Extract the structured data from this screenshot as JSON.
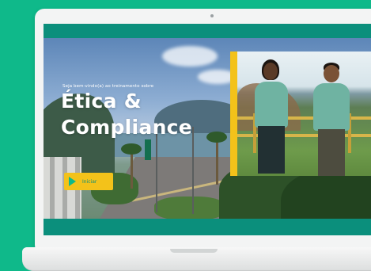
{
  "hero": {
    "welcome_text": "Seja bem-vindo(a) ao treinamento sobre",
    "title_line1": "Ética &",
    "title_line2": "Compliance",
    "start_label": "Iniciar"
  },
  "colors": {
    "background": "#0fb98a",
    "bar": "#0b8f7c",
    "accent": "#f3c21a"
  },
  "icons": {
    "start": "play-icon"
  }
}
